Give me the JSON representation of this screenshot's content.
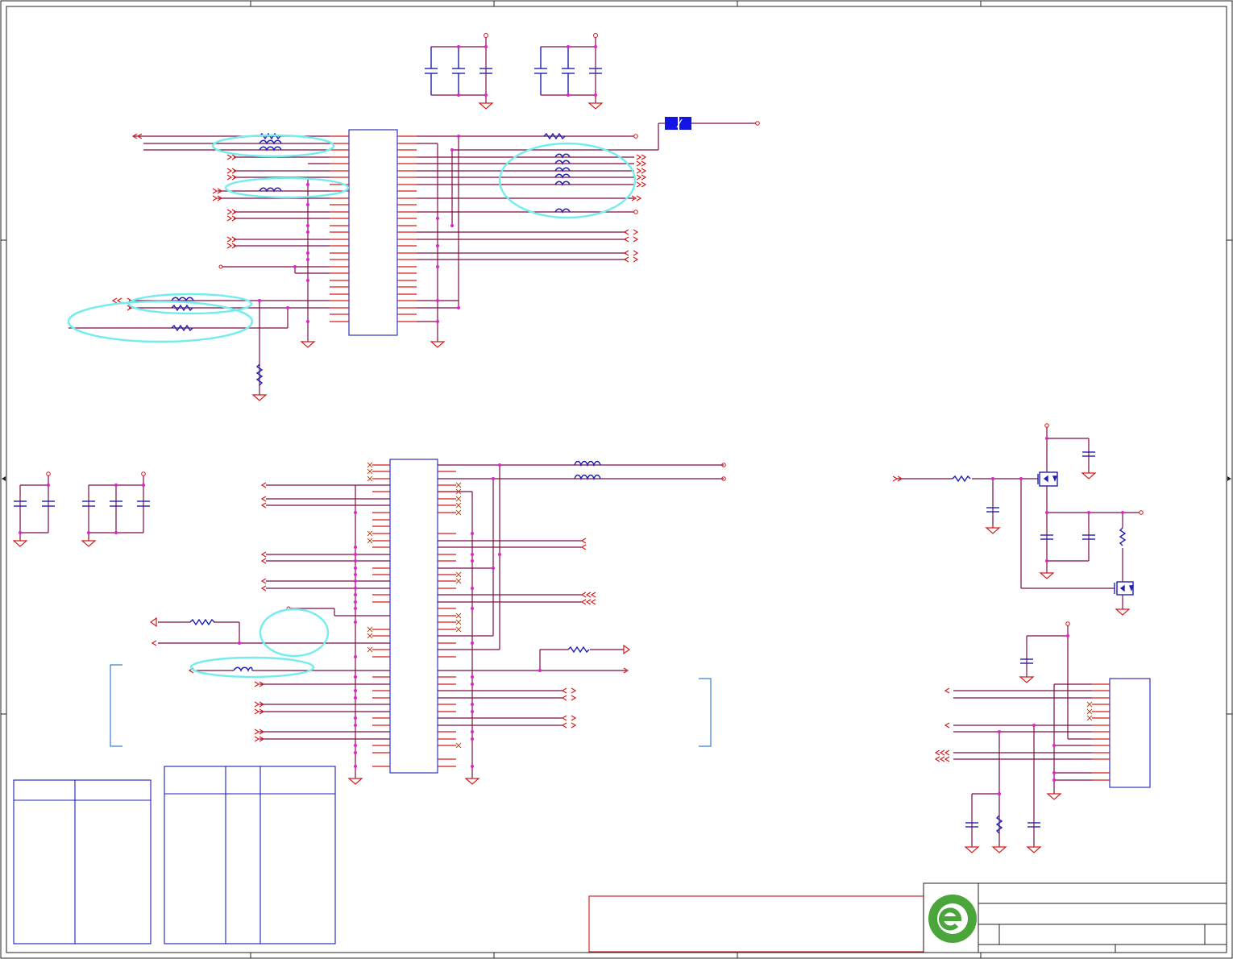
{
  "colors": {
    "wire": "#7a0f45",
    "pin": "#d61a1a",
    "component": "#1f1fb4",
    "highlight": "#74ecef",
    "junction": "#e21fd4",
    "logo_green": "#4aa53a"
  },
  "icons": [
    "ground-symbol",
    "power-port",
    "off-page-connector",
    "mosfet",
    "resistor",
    "capacitor",
    "inductor",
    "ferrite-bead",
    "no-connect-mark"
  ]
}
